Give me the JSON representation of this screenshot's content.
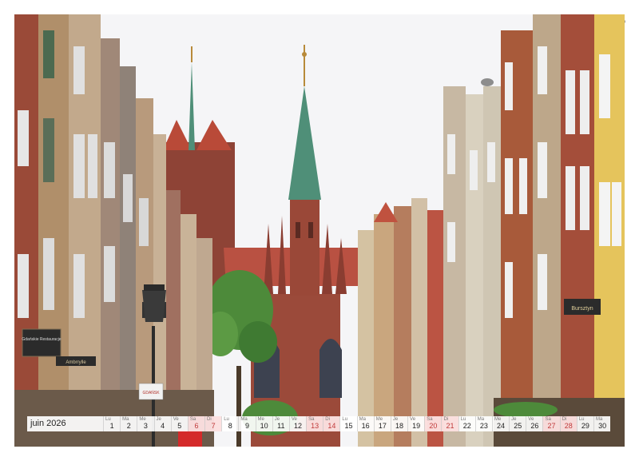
{
  "calendar": {
    "month_label": "juin 2026",
    "days": [
      {
        "wd": "Lu",
        "d": "1"
      },
      {
        "wd": "Ma",
        "d": "2"
      },
      {
        "wd": "Me",
        "d": "3"
      },
      {
        "wd": "Je",
        "d": "4"
      },
      {
        "wd": "Ve",
        "d": "5"
      },
      {
        "wd": "Sa",
        "d": "6"
      },
      {
        "wd": "Di",
        "d": "7"
      },
      {
        "wd": "Lu",
        "d": "8"
      },
      {
        "wd": "Ma",
        "d": "9"
      },
      {
        "wd": "Me",
        "d": "10"
      },
      {
        "wd": "Je",
        "d": "11"
      },
      {
        "wd": "Ve",
        "d": "12"
      },
      {
        "wd": "Sa",
        "d": "13"
      },
      {
        "wd": "Di",
        "d": "14"
      },
      {
        "wd": "Lu",
        "d": "15"
      },
      {
        "wd": "Ma",
        "d": "16"
      },
      {
        "wd": "Me",
        "d": "17"
      },
      {
        "wd": "Je",
        "d": "18"
      },
      {
        "wd": "Ve",
        "d": "19"
      },
      {
        "wd": "Sa",
        "d": "20"
      },
      {
        "wd": "Di",
        "d": "21"
      },
      {
        "wd": "Lu",
        "d": "22"
      },
      {
        "wd": "Ma",
        "d": "23"
      },
      {
        "wd": "Me",
        "d": "24"
      },
      {
        "wd": "Je",
        "d": "25"
      },
      {
        "wd": "Ve",
        "d": "26"
      },
      {
        "wd": "Sa",
        "d": "27"
      },
      {
        "wd": "Di",
        "d": "28"
      },
      {
        "wd": "Lu",
        "d": "29"
      },
      {
        "wd": "Ma",
        "d": "30"
      }
    ]
  },
  "signs": {
    "left_sign": "Gdańskie Restauracje",
    "right_sign": "Bursztyn",
    "lower_sign": "GDAŃSK",
    "small_sign": "Ambrrylle"
  },
  "colors": {
    "sky": "#f4f4f6",
    "brick": "#9b4a3a",
    "roof": "#c0523f",
    "spire": "#4f8f78",
    "tree": "#4d8a3a",
    "weekend": "#c03a3a"
  }
}
